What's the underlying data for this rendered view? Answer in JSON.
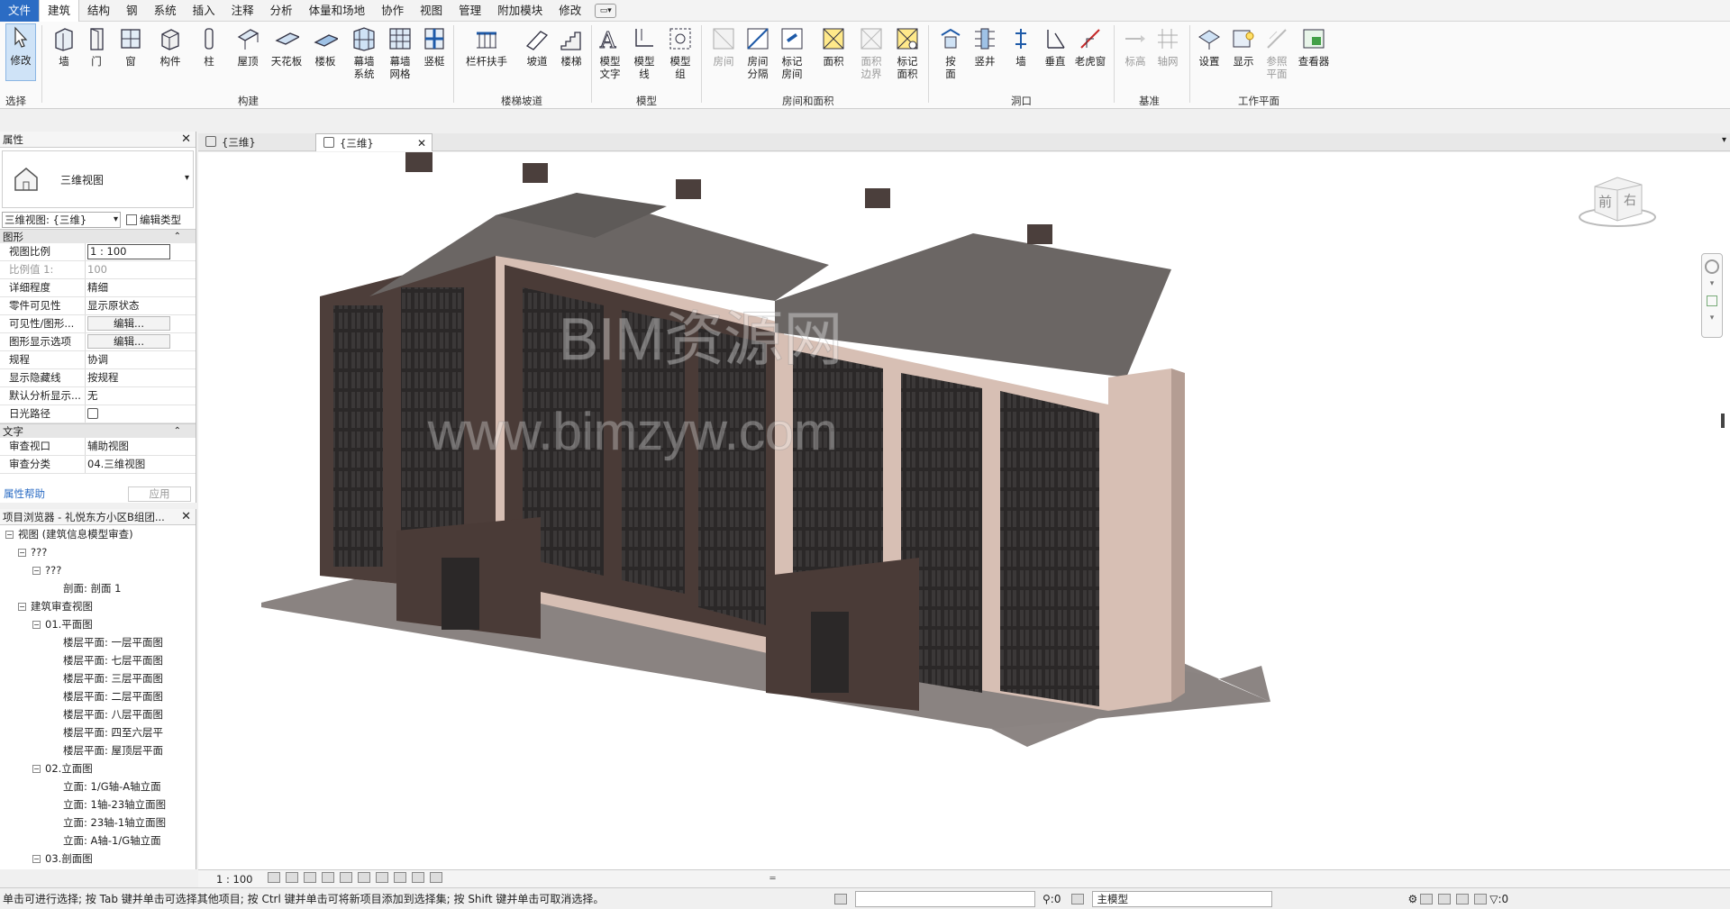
{
  "menu": {
    "tabs": [
      "文件",
      "建筑",
      "结构",
      "钢",
      "系统",
      "插入",
      "注释",
      "分析",
      "体量和场地",
      "协作",
      "视图",
      "管理",
      "附加模块",
      "修改"
    ]
  },
  "ribbon": {
    "tools": [
      {
        "label": "修改",
        "sub": ""
      },
      {
        "label": "墙",
        "sub": ""
      },
      {
        "label": "门",
        "sub": ""
      },
      {
        "label": "窗",
        "sub": ""
      },
      {
        "label": "构件",
        "sub": ""
      },
      {
        "label": "柱",
        "sub": ""
      },
      {
        "label": "屋顶",
        "sub": ""
      },
      {
        "label": "天花板",
        "sub": ""
      },
      {
        "label": "楼板",
        "sub": ""
      },
      {
        "label": "幕墙",
        "sub": "系统"
      },
      {
        "label": "幕墙",
        "sub": "网格"
      },
      {
        "label": "竖梃",
        "sub": ""
      },
      {
        "label": "栏杆扶手",
        "sub": ""
      },
      {
        "label": "坡道",
        "sub": ""
      },
      {
        "label": "楼梯",
        "sub": ""
      },
      {
        "label": "模型",
        "sub": "文字"
      },
      {
        "label": "模型",
        "sub": "线"
      },
      {
        "label": "模型",
        "sub": "组"
      },
      {
        "label": "房间",
        "sub": ""
      },
      {
        "label": "房间",
        "sub": "分隔"
      },
      {
        "label": "标记",
        "sub": "房间"
      },
      {
        "label": "面积",
        "sub": ""
      },
      {
        "label": "面积",
        "sub": "边界"
      },
      {
        "label": "标记",
        "sub": "面积"
      },
      {
        "label": "按",
        "sub": "面"
      },
      {
        "label": "竖井",
        "sub": ""
      },
      {
        "label": "墙",
        "sub": ""
      },
      {
        "label": "垂直",
        "sub": ""
      },
      {
        "label": "老虎窗",
        "sub": ""
      },
      {
        "label": "标高",
        "sub": ""
      },
      {
        "label": "轴网",
        "sub": ""
      },
      {
        "label": "设置",
        "sub": ""
      },
      {
        "label": "显示",
        "sub": ""
      },
      {
        "label": "参照",
        "sub": "平面"
      },
      {
        "label": "查看器",
        "sub": ""
      }
    ],
    "panels": [
      "选择",
      "构建",
      "楼梯坡道",
      "模型",
      "房间和面积",
      "洞口",
      "基准",
      "工作平面"
    ]
  },
  "properties": {
    "title": "属性",
    "type_name": "三维视图",
    "type_selector": "三维视图: {三维}",
    "edit_type": "编辑类型",
    "group_graphics": "图形",
    "rows": [
      {
        "k": "视图比例",
        "v": "1 : 100"
      },
      {
        "k": "比例值 1:",
        "v": "100"
      },
      {
        "k": "详细程度",
        "v": "精细"
      },
      {
        "k": "零件可见性",
        "v": "显示原状态"
      },
      {
        "k": "可见性/图形...",
        "v": "编辑..."
      },
      {
        "k": "图形显示选项",
        "v": "编辑..."
      },
      {
        "k": "规程",
        "v": "协调"
      },
      {
        "k": "显示隐藏线",
        "v": "按规程"
      },
      {
        "k": "默认分析显示...",
        "v": "无"
      },
      {
        "k": "日光路径",
        "v": ""
      }
    ],
    "group_text": "文字",
    "rows2": [
      {
        "k": "审查视口",
        "v": "辅助视图"
      },
      {
        "k": "审查分类",
        "v": "04.三维视图"
      }
    ],
    "help": "属性帮助",
    "apply": "应用"
  },
  "browser": {
    "title": "项目浏览器 - 礼悦东方小区B组团...",
    "nodes": [
      {
        "t": "视图 (建筑信息模型审查)",
        "lvl": 0
      },
      {
        "t": "???",
        "lvl": 1
      },
      {
        "t": "???",
        "lvl": 2
      },
      {
        "t": "剖面: 剖面 1",
        "lvl": 3
      },
      {
        "t": "建筑审查视图",
        "lvl": 1
      },
      {
        "t": "01.平面图",
        "lvl": 2
      },
      {
        "t": "楼层平面: 一层平面图",
        "lvl": 3
      },
      {
        "t": "楼层平面: 七层平面图",
        "lvl": 3
      },
      {
        "t": "楼层平面: 三层平面图",
        "lvl": 3
      },
      {
        "t": "楼层平面: 二层平面图",
        "lvl": 3
      },
      {
        "t": "楼层平面: 八层平面图",
        "lvl": 3
      },
      {
        "t": "楼层平面: 四至六层平",
        "lvl": 3
      },
      {
        "t": "楼层平面: 屋顶层平面",
        "lvl": 3
      },
      {
        "t": "02.立面图",
        "lvl": 2
      },
      {
        "t": "立面: 1/G轴-A轴立面",
        "lvl": 3
      },
      {
        "t": "立面: 1轴-23轴立面图",
        "lvl": 3
      },
      {
        "t": "立面: 23轴-1轴立面图",
        "lvl": 3
      },
      {
        "t": "立面: A轴-1/G轴立面",
        "lvl": 3
      },
      {
        "t": "03.剖面图",
        "lvl": 2
      }
    ]
  },
  "view_tabs": [
    {
      "label": "{三维}",
      "active": false
    },
    {
      "label": "{三维}",
      "active": true
    }
  ],
  "watermark": {
    "line1": "BIM资源网",
    "line2": "www.bimzyw.com"
  },
  "viewcube": {
    "front": "前",
    "right": "右"
  },
  "viewbar": {
    "scale": "1 : 100"
  },
  "status": {
    "hint": "单击可进行选择; 按 Tab 键并单击可选择其他项目; 按 Ctrl 键并单击可将新项目添加到选择集; 按 Shift 键并单击可取消选择。",
    "zero1": ":0",
    "model": "主模型",
    "filter": ":0"
  },
  "colors": {
    "accent": "#2b6cc4",
    "roof": "#5e5a58",
    "frame": "#4a3b37",
    "facade": "#d7bfb4",
    "glass": "#2d2a29",
    "ground": "#8c8583"
  }
}
